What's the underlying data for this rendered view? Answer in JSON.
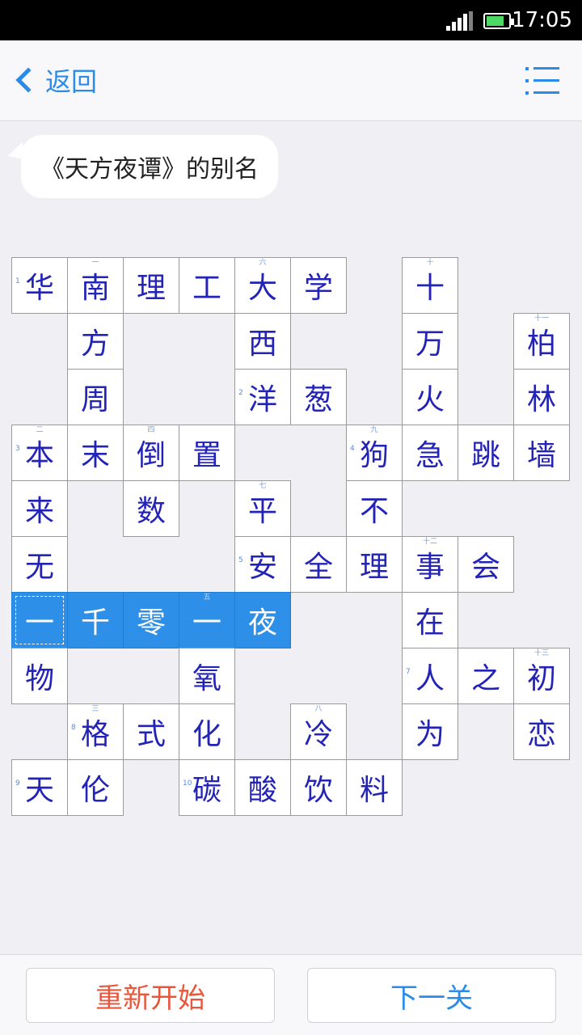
{
  "status_bar": {
    "time": "17:05"
  },
  "header": {
    "back_label": "返回",
    "menu_icon": "list-menu-icon"
  },
  "clue": {
    "text": "《天方夜谭》的别名"
  },
  "colors": {
    "accent": "#2a8be8",
    "highlight": "#2e8fe8",
    "cell_text": "#2323b8",
    "restart": "#e8573c"
  },
  "puzzle": {
    "cells": [
      {
        "r": 0,
        "c": 0,
        "t": "华",
        "n": "1"
      },
      {
        "r": 0,
        "c": 1,
        "t": "南",
        "m": "一"
      },
      {
        "r": 0,
        "c": 2,
        "t": "理"
      },
      {
        "r": 0,
        "c": 3,
        "t": "工"
      },
      {
        "r": 0,
        "c": 4,
        "t": "大",
        "m": "六"
      },
      {
        "r": 0,
        "c": 5,
        "t": "学"
      },
      {
        "r": 0,
        "c": 7,
        "t": "十",
        "m": "十"
      },
      {
        "r": 1,
        "c": 1,
        "t": "方"
      },
      {
        "r": 1,
        "c": 4,
        "t": "西"
      },
      {
        "r": 1,
        "c": 7,
        "t": "万"
      },
      {
        "r": 1,
        "c": 9,
        "t": "柏",
        "m": "十一"
      },
      {
        "r": 2,
        "c": 1,
        "t": "周"
      },
      {
        "r": 2,
        "c": 4,
        "t": "洋",
        "n": "2"
      },
      {
        "r": 2,
        "c": 5,
        "t": "葱"
      },
      {
        "r": 2,
        "c": 7,
        "t": "火"
      },
      {
        "r": 2,
        "c": 9,
        "t": "林"
      },
      {
        "r": 3,
        "c": 0,
        "t": "本",
        "n": "3",
        "m": "二"
      },
      {
        "r": 3,
        "c": 1,
        "t": "末"
      },
      {
        "r": 3,
        "c": 2,
        "t": "倒",
        "m": "四"
      },
      {
        "r": 3,
        "c": 3,
        "t": "置"
      },
      {
        "r": 3,
        "c": 6,
        "t": "狗",
        "n": "4",
        "m": "九"
      },
      {
        "r": 3,
        "c": 7,
        "t": "急"
      },
      {
        "r": 3,
        "c": 8,
        "t": "跳"
      },
      {
        "r": 3,
        "c": 9,
        "t": "墙"
      },
      {
        "r": 4,
        "c": 0,
        "t": "来"
      },
      {
        "r": 4,
        "c": 2,
        "t": "数"
      },
      {
        "r": 4,
        "c": 4,
        "t": "平",
        "m": "七"
      },
      {
        "r": 4,
        "c": 6,
        "t": "不"
      },
      {
        "r": 5,
        "c": 0,
        "t": "无"
      },
      {
        "r": 5,
        "c": 4,
        "t": "安",
        "n": "5"
      },
      {
        "r": 5,
        "c": 5,
        "t": "全"
      },
      {
        "r": 5,
        "c": 6,
        "t": "理"
      },
      {
        "r": 5,
        "c": 7,
        "t": "事",
        "m": "十二"
      },
      {
        "r": 5,
        "c": 8,
        "t": "会"
      },
      {
        "r": 6,
        "c": 0,
        "t": "一",
        "hl": true,
        "sel": true
      },
      {
        "r": 6,
        "c": 1,
        "t": "千",
        "hl": true
      },
      {
        "r": 6,
        "c": 2,
        "t": "零",
        "hl": true
      },
      {
        "r": 6,
        "c": 3,
        "t": "一",
        "hl": true,
        "m": "五"
      },
      {
        "r": 6,
        "c": 4,
        "t": "夜",
        "hl": true
      },
      {
        "r": 6,
        "c": 7,
        "t": "在"
      },
      {
        "r": 7,
        "c": 0,
        "t": "物"
      },
      {
        "r": 7,
        "c": 3,
        "t": "氧"
      },
      {
        "r": 7,
        "c": 7,
        "t": "人",
        "n": "7"
      },
      {
        "r": 7,
        "c": 8,
        "t": "之"
      },
      {
        "r": 7,
        "c": 9,
        "t": "初",
        "m": "十三"
      },
      {
        "r": 8,
        "c": 1,
        "t": "格",
        "n": "8",
        "m": "三"
      },
      {
        "r": 8,
        "c": 2,
        "t": "式"
      },
      {
        "r": 8,
        "c": 3,
        "t": "化"
      },
      {
        "r": 8,
        "c": 5,
        "t": "冷",
        "m": "八"
      },
      {
        "r": 8,
        "c": 7,
        "t": "为"
      },
      {
        "r": 8,
        "c": 9,
        "t": "恋"
      },
      {
        "r": 9,
        "c": 0,
        "t": "天",
        "n": "9"
      },
      {
        "r": 9,
        "c": 1,
        "t": "伦"
      },
      {
        "r": 9,
        "c": 3,
        "t": "碳",
        "n": "10"
      },
      {
        "r": 9,
        "c": 4,
        "t": "酸"
      },
      {
        "r": 9,
        "c": 5,
        "t": "饮"
      },
      {
        "r": 9,
        "c": 6,
        "t": "料"
      }
    ]
  },
  "footer": {
    "restart_label": "重新开始",
    "next_label": "下一关"
  }
}
